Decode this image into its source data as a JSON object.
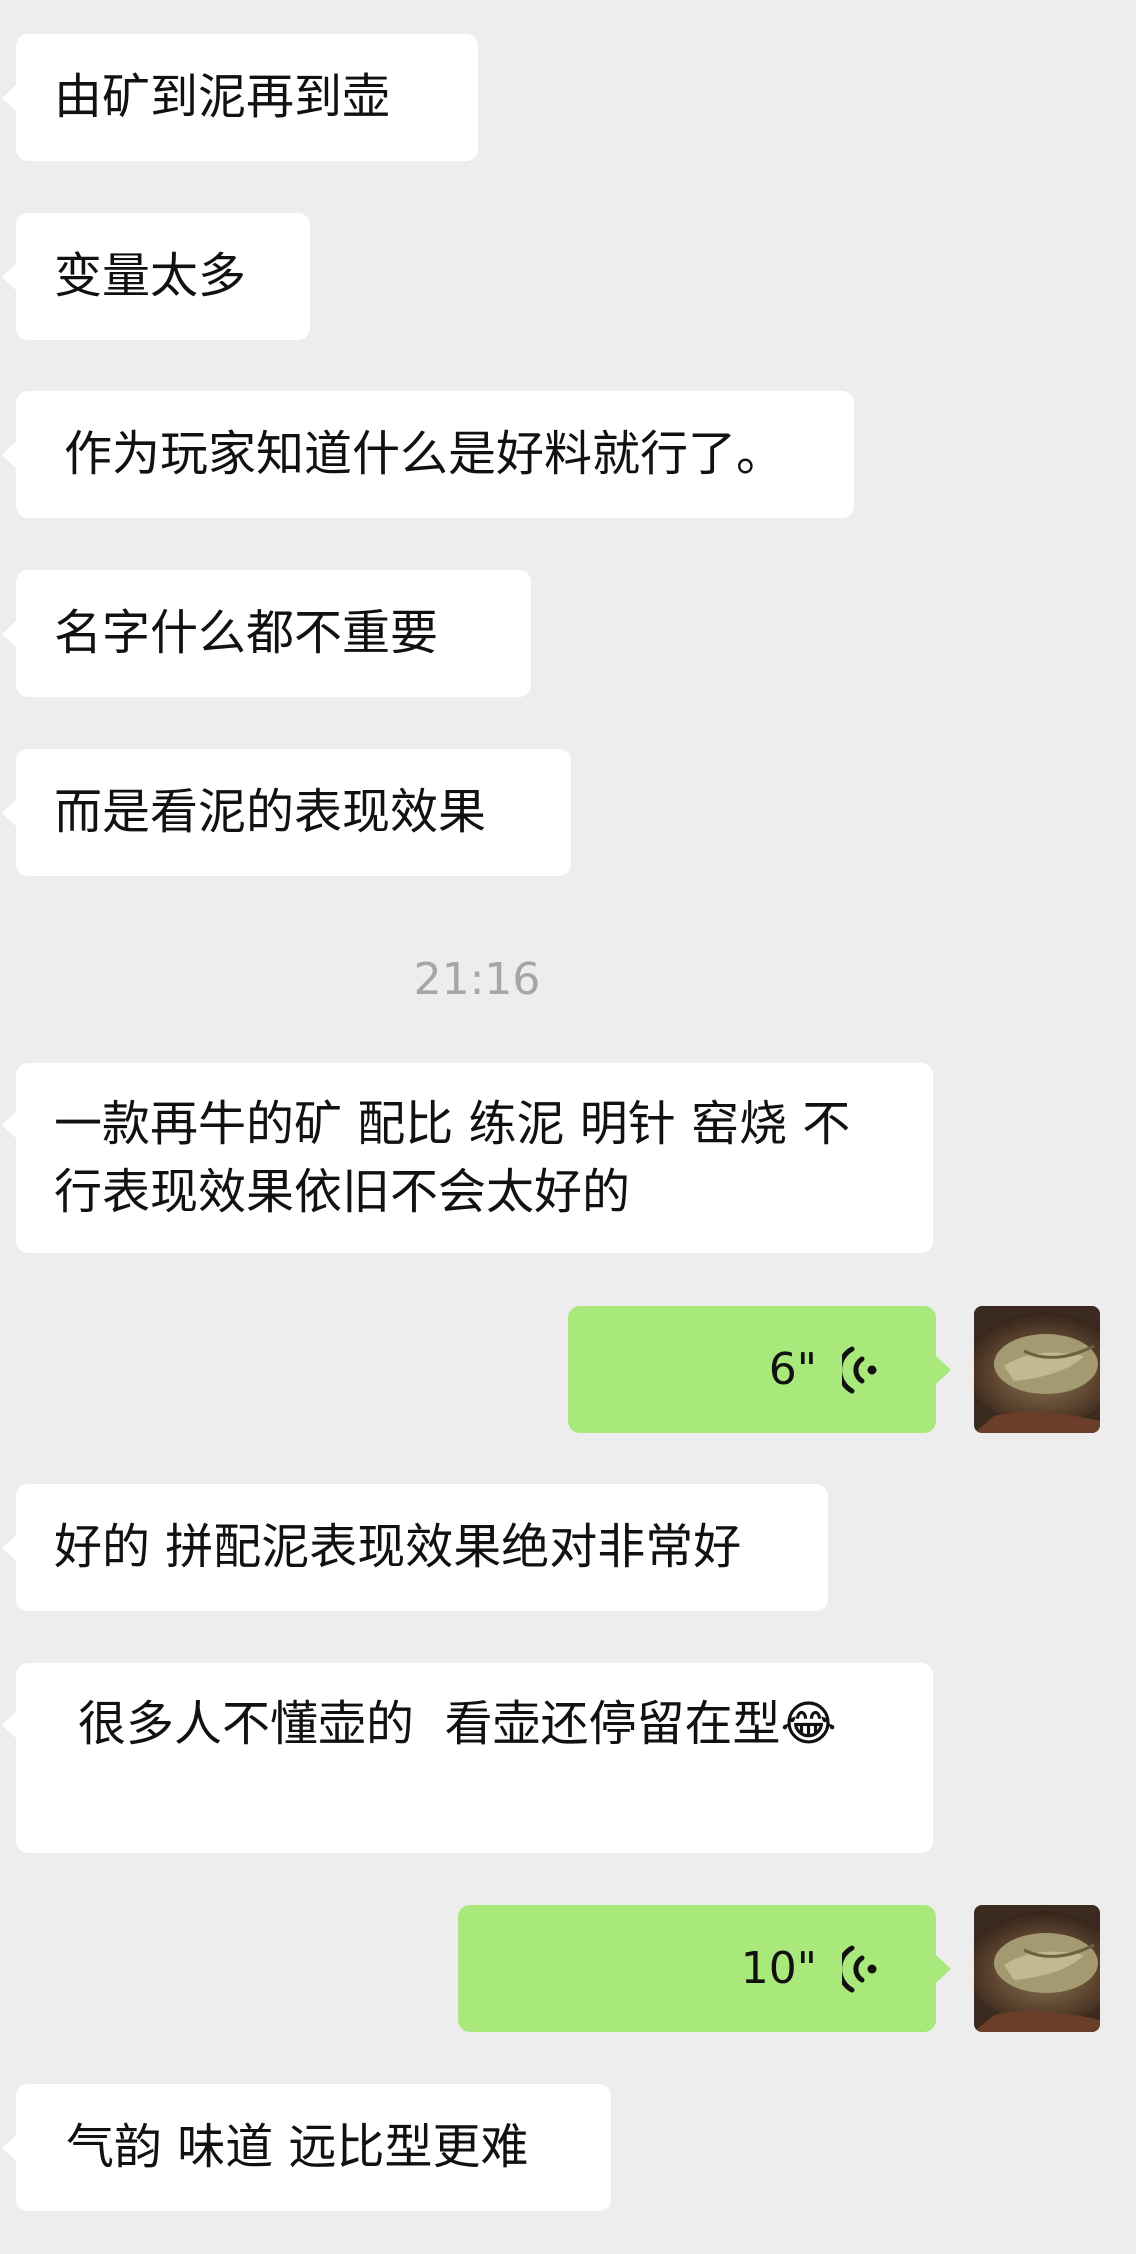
{
  "messages": [
    {
      "text": "由矿到泥再到壶"
    },
    {
      "text": "变量太多"
    },
    {
      "text": "作为玩家知道什么是好料就行了。"
    },
    {
      "text": "名字什么都不重要"
    },
    {
      "text": "而是看泥的表现效果"
    },
    {
      "text": "一款再牛的矿 配比 练泥 明针 窑烧 不\n行表现效果依旧不会太好的"
    },
    {
      "text": "好的 拼配泥表现效果绝对非常好"
    },
    {
      "text": "很多人不懂壶的  看壶还停留在型😂"
    },
    {
      "text": "气韵 味道 远比型更难"
    }
  ],
  "timestamp": "21:16",
  "voice_messages": [
    {
      "duration": "6\""
    },
    {
      "duration": "10\""
    }
  ],
  "colors": {
    "background": "#ededed",
    "incoming_bubble": "#ffffff",
    "outgoing_bubble": "#a9e87b",
    "timestamp": "#a6a6a6"
  },
  "icons": {
    "voice": "voice-wave-icon",
    "avatar": "avatar-image"
  }
}
